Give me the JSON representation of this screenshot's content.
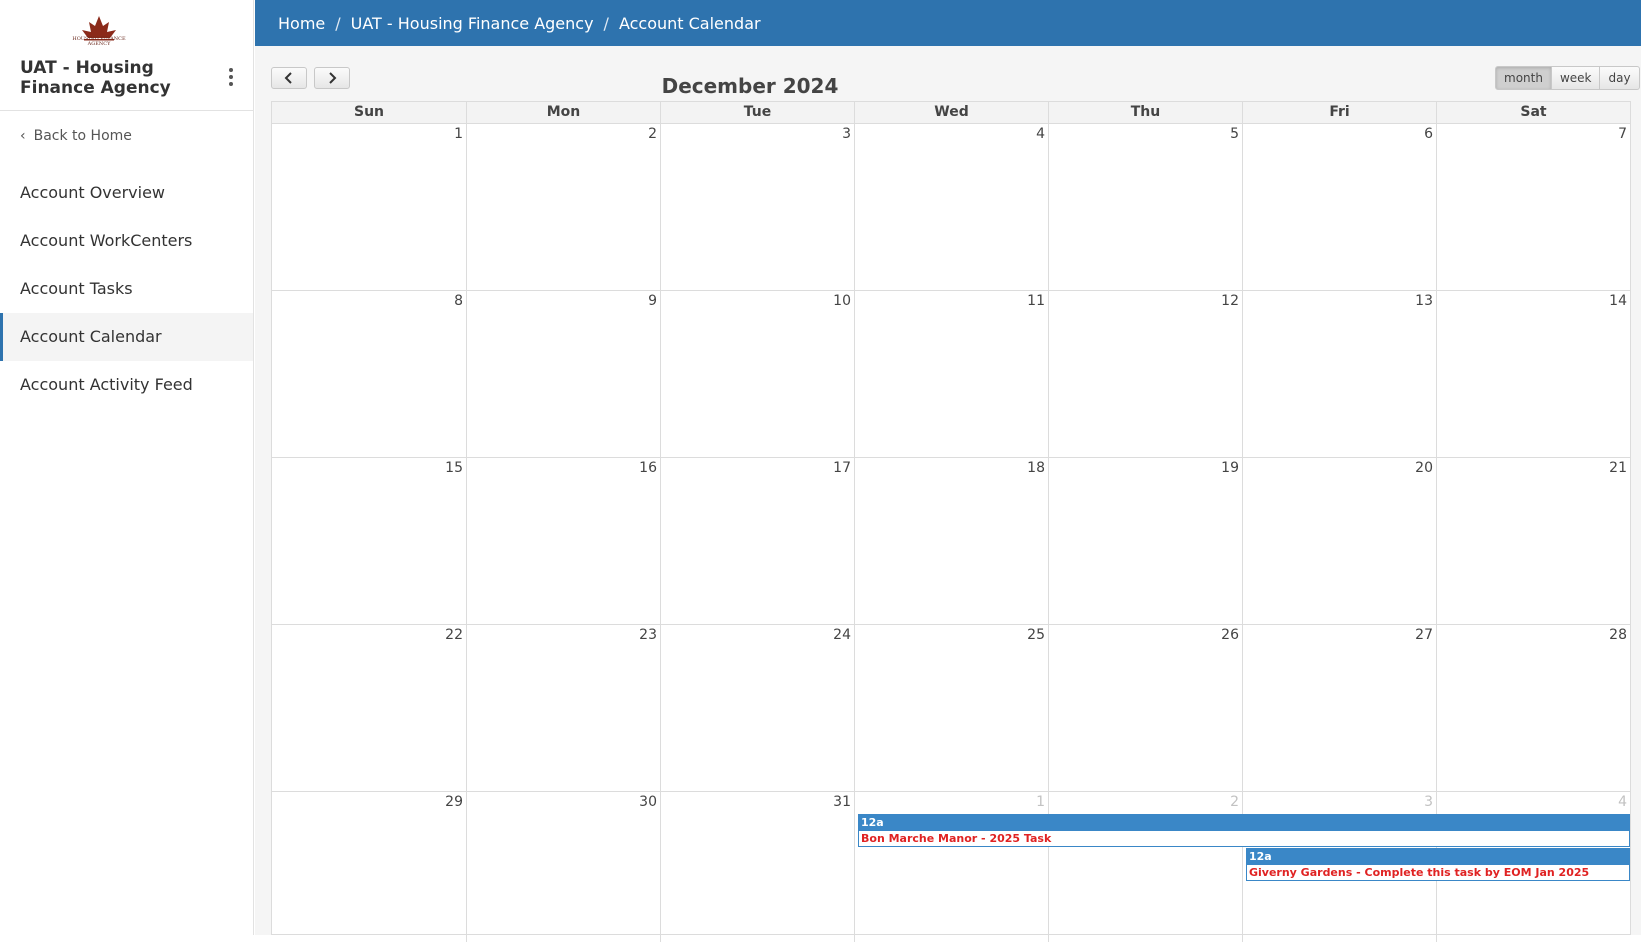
{
  "sidebar": {
    "logo_text": "HOUSING FINANCE AGENCY",
    "account_title": "UAT - Housing Finance Agency",
    "back_label": "Back to Home",
    "items": [
      {
        "label": "Account Overview"
      },
      {
        "label": "Account WorkCenters"
      },
      {
        "label": "Account Tasks"
      },
      {
        "label": "Account Calendar",
        "active": true
      },
      {
        "label": "Account Activity Feed"
      }
    ]
  },
  "breadcrumb": {
    "items": [
      "Home",
      "UAT - Housing Finance Agency",
      "Account Calendar"
    ],
    "separator": "/"
  },
  "calendar": {
    "title": "December 2024",
    "views": [
      "month",
      "week",
      "day"
    ],
    "active_view": "month",
    "weekdays": [
      "Sun",
      "Mon",
      "Tue",
      "Wed",
      "Thu",
      "Fri",
      "Sat"
    ],
    "weeks": [
      [
        {
          "d": "1"
        },
        {
          "d": "2"
        },
        {
          "d": "3"
        },
        {
          "d": "4"
        },
        {
          "d": "5"
        },
        {
          "d": "6"
        },
        {
          "d": "7"
        }
      ],
      [
        {
          "d": "8"
        },
        {
          "d": "9"
        },
        {
          "d": "10"
        },
        {
          "d": "11"
        },
        {
          "d": "12"
        },
        {
          "d": "13"
        },
        {
          "d": "14"
        }
      ],
      [
        {
          "d": "15"
        },
        {
          "d": "16"
        },
        {
          "d": "17"
        },
        {
          "d": "18"
        },
        {
          "d": "19"
        },
        {
          "d": "20"
        },
        {
          "d": "21"
        }
      ],
      [
        {
          "d": "22"
        },
        {
          "d": "23"
        },
        {
          "d": "24"
        },
        {
          "d": "25"
        },
        {
          "d": "26"
        },
        {
          "d": "27"
        },
        {
          "d": "28"
        }
      ],
      [
        {
          "d": "29"
        },
        {
          "d": "30"
        },
        {
          "d": "31"
        },
        {
          "d": "1",
          "other": true
        },
        {
          "d": "2",
          "other": true
        },
        {
          "d": "3",
          "other": true
        },
        {
          "d": "4",
          "other": true
        }
      ]
    ],
    "events": [
      {
        "time": "12a",
        "title": "Bon Marche Manor - 2025 Task"
      },
      {
        "time": "12a",
        "title": "Giverny Gardens - Complete this task by EOM Jan 2025"
      }
    ]
  },
  "colors": {
    "topbar": "#2e73ae",
    "event_bar": "#3a87c7",
    "event_text": "#e02222",
    "logo": "#8b2a1a"
  }
}
